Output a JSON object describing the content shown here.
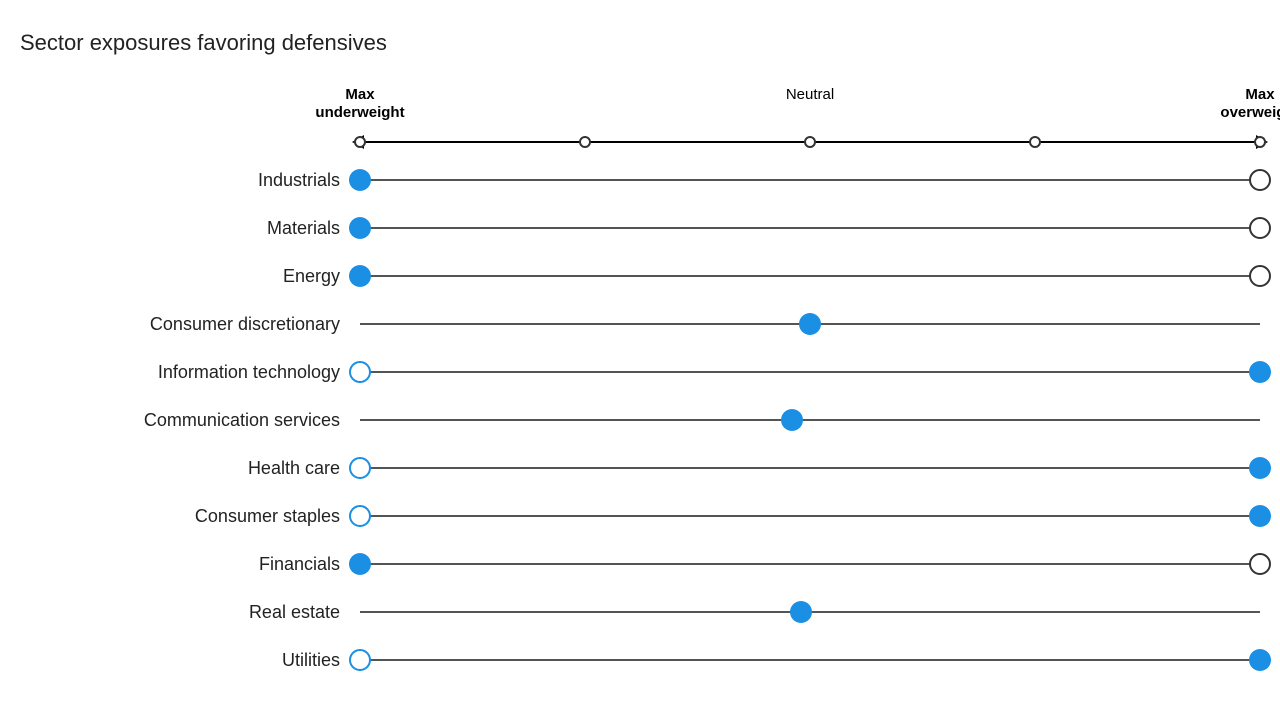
{
  "title": "Sector exposures favoring defensives",
  "axis": {
    "left_label": "Max\nunderweight",
    "neutral_label": "Neutral",
    "right_label": "Max\noverweight"
  },
  "rows": [
    {
      "label": "Industrials",
      "left_dot": {
        "type": "filled",
        "position": 0
      },
      "right_dot": {
        "type": "empty-dark",
        "position": 100
      }
    },
    {
      "label": "Materials",
      "left_dot": {
        "type": "filled",
        "position": 0
      },
      "right_dot": {
        "type": "empty-dark",
        "position": 100
      }
    },
    {
      "label": "Energy",
      "left_dot": {
        "type": "filled",
        "position": 0
      },
      "right_dot": {
        "type": "empty-dark",
        "position": 100
      }
    },
    {
      "label": "Consumer discretionary",
      "left_dot": null,
      "right_dot": null,
      "center_dot": {
        "type": "filled",
        "position": 50
      }
    },
    {
      "label": "Information technology",
      "left_dot": {
        "type": "empty-blue",
        "position": 0
      },
      "right_dot": {
        "type": "filled",
        "position": 100
      }
    },
    {
      "label": "Communication services",
      "left_dot": null,
      "right_dot": null,
      "center_dot": {
        "type": "filled",
        "position": 48
      }
    },
    {
      "label": "Health care",
      "left_dot": {
        "type": "empty-blue",
        "position": 0
      },
      "right_dot": {
        "type": "filled",
        "position": 100
      }
    },
    {
      "label": "Consumer staples",
      "left_dot": {
        "type": "empty-blue",
        "position": 0
      },
      "right_dot": {
        "type": "filled",
        "position": 100
      }
    },
    {
      "label": "Financials",
      "left_dot": {
        "type": "filled",
        "position": 0
      },
      "right_dot": {
        "type": "empty-dark",
        "position": 100
      }
    },
    {
      "label": "Real estate",
      "left_dot": null,
      "right_dot": null,
      "center_dot": {
        "type": "filled",
        "position": 49
      }
    },
    {
      "label": "Utilities",
      "left_dot": {
        "type": "empty-blue",
        "position": 0
      },
      "right_dot": {
        "type": "filled",
        "position": 100
      }
    }
  ]
}
